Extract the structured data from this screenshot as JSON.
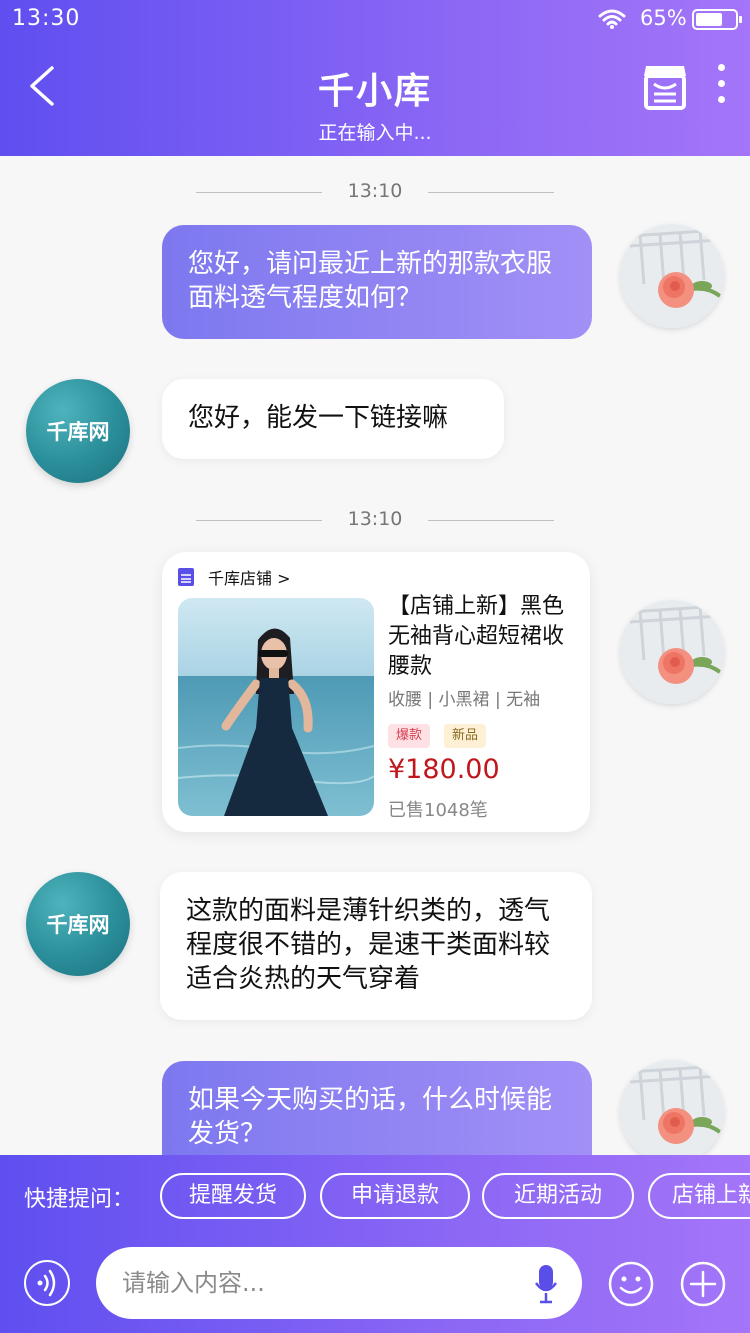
{
  "status_bar": {
    "time": "13:30",
    "battery": "65%"
  },
  "header": {
    "title": "千小库",
    "subtitle": "正在输入中..."
  },
  "messages": {
    "time_1": "13:10",
    "time_2": "13:10",
    "user_1": "您好，请问最近上新的那款衣服面料透气程度如何？",
    "shop_1": "您好，能发一下链接嘛",
    "shop_2": "这款的面料是薄针织类的，透气程度很不错的，是速干类面料较适合炎热的天气穿着",
    "user_2": "如果今天购买的话，什么时候能发货？"
  },
  "shop_avatar_text": "千库网",
  "product_card": {
    "store_link": "千库店铺 >",
    "title": "【店铺上新】黑色无袖背心超短裙收腰款",
    "tags": "收腰 | 小黑裙 | 无袖",
    "badge_hot": "爆款",
    "badge_new": "新品",
    "price": "¥180.00",
    "sold": "已售1048笔"
  },
  "quick_questions": {
    "label": "快捷提问：",
    "items": [
      "提醒发货",
      "申请退款",
      "近期活动",
      "店铺上新"
    ]
  },
  "input": {
    "placeholder": "请输入内容..."
  },
  "colors": {
    "primary": "#5f4ff0",
    "accent": "#a475f8",
    "price": "#c0171d"
  }
}
